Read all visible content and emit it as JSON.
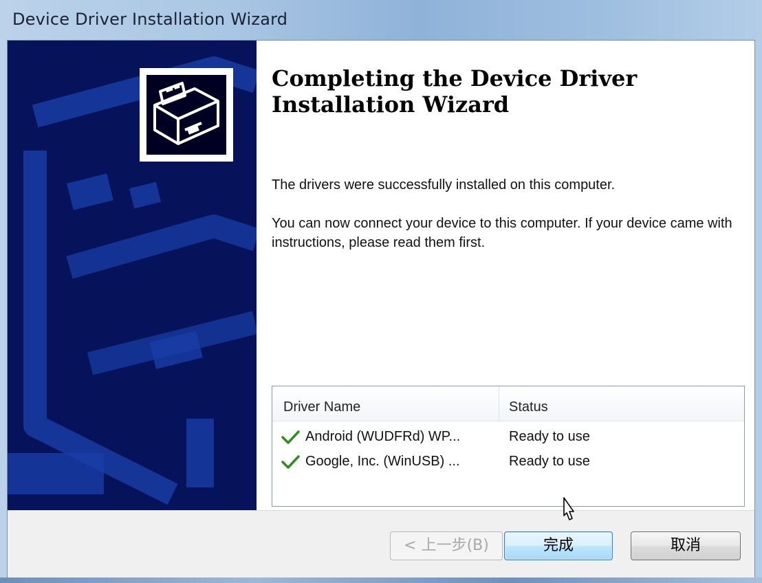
{
  "window": {
    "title": "Device Driver Installation Wizard"
  },
  "sidebar": {
    "logo_icon": "device-drive-icon"
  },
  "main": {
    "heading": "Completing the Device Driver Installation Wizard",
    "paragraph1": "The drivers were successfully installed on this computer.",
    "paragraph2": "You can now connect your device to this computer. If your device came with instructions, please read them first."
  },
  "drivers_table": {
    "columns": [
      "Driver Name",
      "Status"
    ],
    "rows": [
      {
        "name": "Android (WUDFRd) WP...",
        "status": "Ready to use",
        "icon": "checkmark-icon"
      },
      {
        "name": "Google, Inc. (WinUSB) ...",
        "status": "Ready to use",
        "icon": "checkmark-icon"
      }
    ]
  },
  "buttons": {
    "back": "< 上一步(B)",
    "finish": "完成",
    "cancel": "取消"
  },
  "colors": {
    "sidebar": "#06135a",
    "check": "#2f8a1f",
    "finish_border": "#3c7fb1"
  }
}
